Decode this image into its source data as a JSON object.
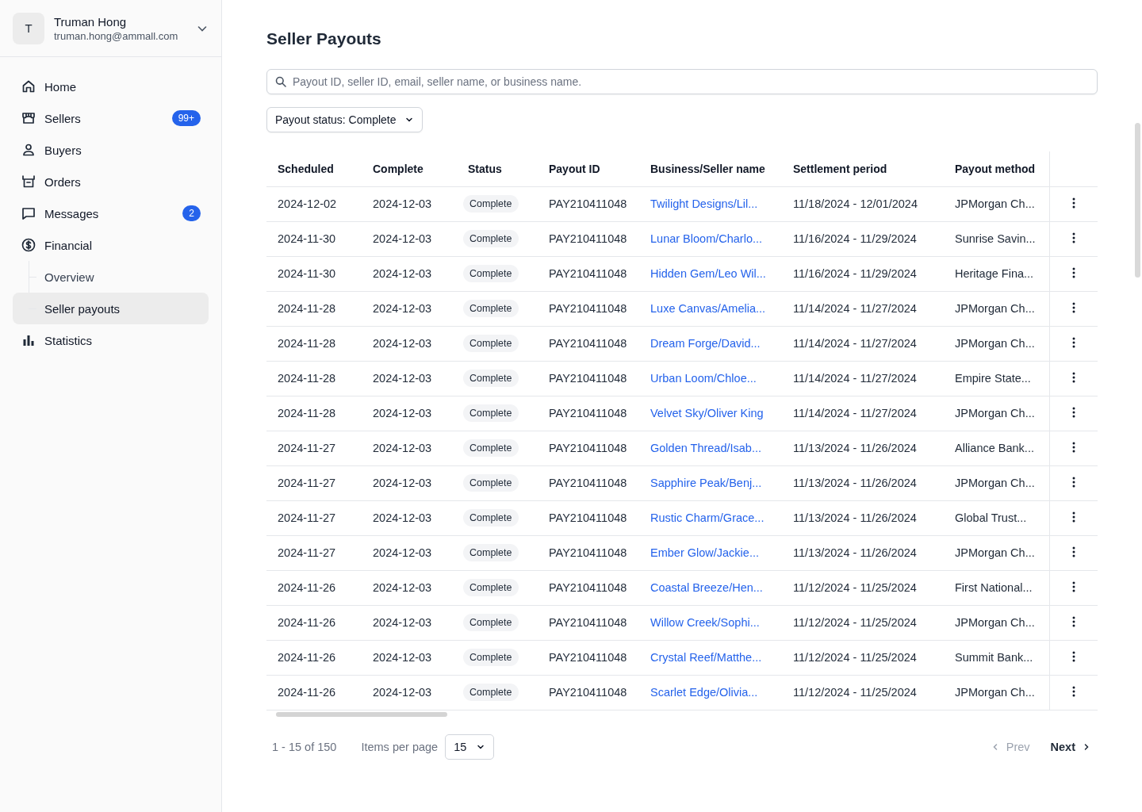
{
  "account": {
    "initial": "T",
    "name": "Truman Hong",
    "email": "truman.hong@ammall.com"
  },
  "nav": [
    {
      "label": "Home",
      "kind": "home",
      "selected": false
    },
    {
      "label": "Sellers",
      "kind": "store",
      "badge": "99+",
      "selected": false
    },
    {
      "label": "Buyers",
      "kind": "person",
      "selected": false
    },
    {
      "label": "Orders",
      "kind": "box",
      "selected": false
    },
    {
      "label": "Messages",
      "kind": "chat",
      "badge": "2",
      "selected": false
    },
    {
      "label": "Financial",
      "kind": "dollar",
      "selected": false,
      "children": [
        {
          "label": "Overview",
          "selected": false
        },
        {
          "label": "Seller payouts",
          "selected": true
        }
      ]
    },
    {
      "label": "Statistics",
      "kind": "chart",
      "selected": false
    }
  ],
  "page_title": "Seller Payouts",
  "search": {
    "placeholder": "Payout ID, seller ID, email, seller name, or business name."
  },
  "filter": {
    "label": "Payout status: Complete"
  },
  "table": {
    "columns": [
      "Scheduled",
      "Complete",
      "Status",
      "Payout ID",
      "Business/Seller name",
      "Settlement period",
      "Payout method"
    ],
    "rows": [
      [
        "2024-12-02",
        "2024-12-03",
        "Complete",
        "PAY210411048",
        "Twilight Designs/Lil...",
        "11/18/2024 - 12/01/2024",
        "JPMorgan Ch..."
      ],
      [
        "2024-11-30",
        "2024-12-03",
        "Complete",
        "PAY210411048",
        "Lunar Bloom/Charlo...",
        "11/16/2024 - 11/29/2024",
        "Sunrise Savin..."
      ],
      [
        "2024-11-30",
        "2024-12-03",
        "Complete",
        "PAY210411048",
        "Hidden Gem/Leo Wil...",
        "11/16/2024 - 11/29/2024",
        "Heritage Fina..."
      ],
      [
        "2024-11-28",
        "2024-12-03",
        "Complete",
        "PAY210411048",
        "Luxe Canvas/Amelia...",
        "11/14/2024 - 11/27/2024",
        "JPMorgan Ch..."
      ],
      [
        "2024-11-28",
        "2024-12-03",
        "Complete",
        "PAY210411048",
        "Dream Forge/David...",
        "11/14/2024 - 11/27/2024",
        "JPMorgan Ch..."
      ],
      [
        "2024-11-28",
        "2024-12-03",
        "Complete",
        "PAY210411048",
        "Urban Loom/Chloe...",
        "11/14/2024 - 11/27/2024",
        "Empire State..."
      ],
      [
        "2024-11-28",
        "2024-12-03",
        "Complete",
        "PAY210411048",
        "Velvet Sky/Oliver King",
        "11/14/2024 - 11/27/2024",
        "JPMorgan Ch..."
      ],
      [
        "2024-11-27",
        "2024-12-03",
        "Complete",
        "PAY210411048",
        "Golden Thread/Isab...",
        "11/13/2024 - 11/26/2024",
        "Alliance Bank..."
      ],
      [
        "2024-11-27",
        "2024-12-03",
        "Complete",
        "PAY210411048",
        "Sapphire Peak/Benj...",
        "11/13/2024 - 11/26/2024",
        "JPMorgan Ch..."
      ],
      [
        "2024-11-27",
        "2024-12-03",
        "Complete",
        "PAY210411048",
        "Rustic Charm/Grace...",
        "11/13/2024 - 11/26/2024",
        "Global Trust..."
      ],
      [
        "2024-11-27",
        "2024-12-03",
        "Complete",
        "PAY210411048",
        "Ember Glow/Jackie...",
        "11/13/2024 - 11/26/2024",
        "JPMorgan Ch..."
      ],
      [
        "2024-11-26",
        "2024-12-03",
        "Complete",
        "PAY210411048",
        "Coastal Breeze/Hen...",
        "11/12/2024 - 11/25/2024",
        "First National..."
      ],
      [
        "2024-11-26",
        "2024-12-03",
        "Complete",
        "PAY210411048",
        "Willow Creek/Sophi...",
        "11/12/2024 - 11/25/2024",
        "JPMorgan Ch..."
      ],
      [
        "2024-11-26",
        "2024-12-03",
        "Complete",
        "PAY210411048",
        "Crystal Reef/Matthe...",
        "11/12/2024 - 11/25/2024",
        "Summit Bank..."
      ],
      [
        "2024-11-26",
        "2024-12-03",
        "Complete",
        "PAY210411048",
        "Scarlet Edge/Olivia...",
        "11/12/2024 - 11/25/2024",
        "JPMorgan Ch..."
      ]
    ]
  },
  "pagination": {
    "range": "1 - 15 of 150",
    "per_page_label": "Items per page",
    "per_page": "15",
    "prev": {
      "label": "Prev",
      "disabled": true
    },
    "next": {
      "label": "Next",
      "disabled": false
    }
  }
}
